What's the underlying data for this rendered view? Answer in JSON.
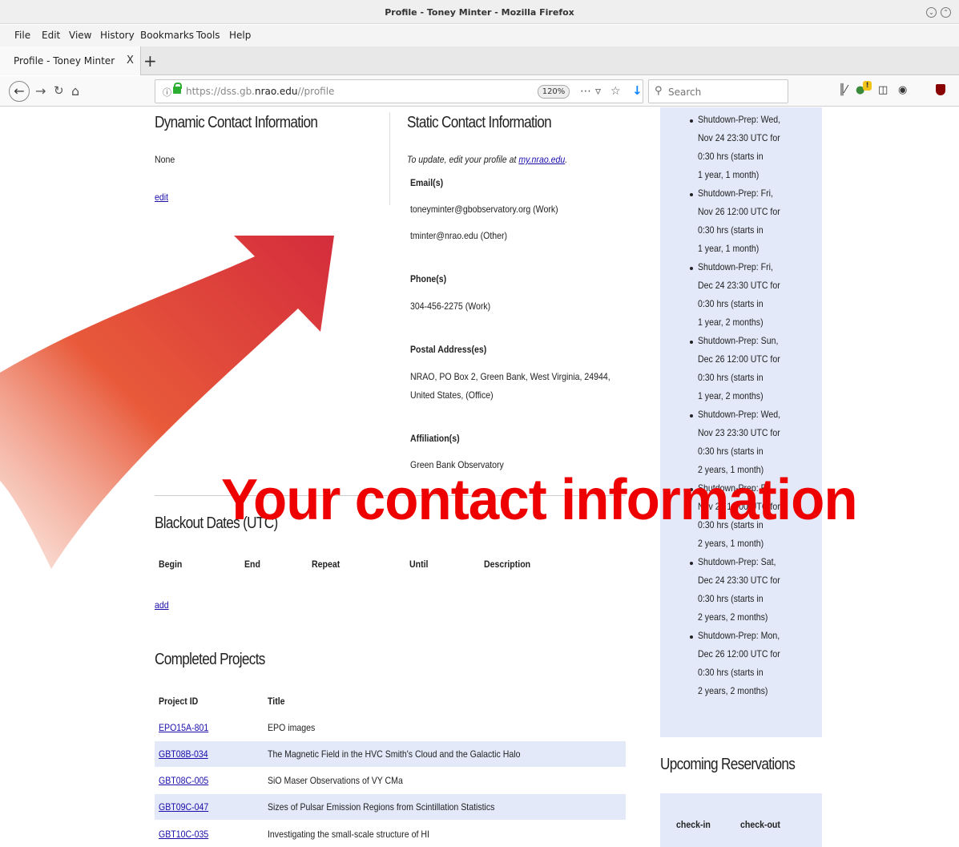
{
  "window": {
    "title": "Profile - Toney Minter - Mozilla Firefox"
  },
  "menubar": {
    "items": [
      "File",
      "Edit",
      "View",
      "History",
      "Bookmarks",
      "Tools",
      "Help"
    ]
  },
  "tabs": [
    {
      "label": "Profile - Toney Minter",
      "close": "X"
    }
  ],
  "newtab_label": "+",
  "navbar": {
    "url_prefix": "https://dss.gb.",
    "url_host": "nrao.edu",
    "url_suffix": "//profile",
    "zoom": "120%",
    "search_placeholder": "Search"
  },
  "dynamic_contact": {
    "heading": "Dynamic Contact Information",
    "value": "None",
    "edit_link": "edit"
  },
  "static_contact": {
    "heading": "Static Contact Information",
    "note_prefix": "To update, edit your profile at ",
    "note_link": "my.nrao.edu",
    "note_suffix": ".",
    "emails_label": "Email(s)",
    "emails": [
      "toneyminter@gbobservatory.org (Work)",
      "tminter@nrao.edu (Other)"
    ],
    "phones_label": "Phone(s)",
    "phones": [
      "304-456-2275 (Work)"
    ],
    "postal_label": "Postal Address(es)",
    "postal_line1": "NRAO, PO Box 2, Green Bank, West Virginia, 24944,",
    "postal_line2": "United States, (Office)",
    "affiliation_label": "Affiliation(s)",
    "affiliations": [
      "Green Bank Observatory"
    ]
  },
  "blackout": {
    "heading": "Blackout Dates (UTC)",
    "columns": [
      "Begin",
      "End",
      "Repeat",
      "Until",
      "Description"
    ],
    "add_link": "add"
  },
  "completed_projects": {
    "heading": "Completed Projects",
    "columns": [
      "Project ID",
      "Title"
    ],
    "rows": [
      {
        "id": "EPO15A-801",
        "title": "EPO images"
      },
      {
        "id": "GBT08B-034",
        "title": "The Magnetic Field in the HVC Smith's Cloud and the Galactic Halo"
      },
      {
        "id": "GBT08C-005",
        "title": "SiO Maser Observations of VY CMa"
      },
      {
        "id": "GBT09C-047",
        "title": "Sizes of Pulsar Emission Regions from Scintillation Statistics"
      },
      {
        "id": "GBT10C-035",
        "title": "Investigating the small-scale structure of HI"
      }
    ]
  },
  "shutdowns": [
    [
      "Shutdown-Prep: Wed,",
      "Nov 24 23:30 UTC for",
      "0:30 hrs (starts in",
      "1 year, 1 month)"
    ],
    [
      "Shutdown-Prep: Fri,",
      "Nov 26 12:00 UTC for",
      "0:30 hrs (starts in",
      "1 year, 1 month)"
    ],
    [
      "Shutdown-Prep: Fri,",
      "Dec 24 23:30 UTC for",
      "0:30 hrs (starts in",
      "1 year, 2 months)"
    ],
    [
      "Shutdown-Prep: Sun,",
      "Dec 26 12:00 UTC for",
      "0:30 hrs (starts in",
      "1 year, 2 months)"
    ],
    [
      "Shutdown-Prep: Wed,",
      "Nov 23 23:30 UTC for",
      "0:30 hrs (starts in",
      "2 years, 1 month)"
    ],
    [
      "Shutdown-Prep: Fri,",
      "Nov 25 12:00 UTC for",
      "0:30 hrs (starts in",
      "2 years, 1 month)"
    ],
    [
      "Shutdown-Prep: Sat,",
      "Dec 24 23:30 UTC for",
      "0:30 hrs (starts in",
      "2 years, 2 months)"
    ],
    [
      "Shutdown-Prep: Mon,",
      "Dec 26 12:00 UTC for",
      "0:30 hrs (starts in",
      "2 years, 2 months)"
    ]
  ],
  "upcoming_reservations": {
    "heading": "Upcoming Reservations",
    "columns": [
      "check-in",
      "check-out"
    ]
  },
  "annotation": {
    "text": "Your contact information",
    "color": "#ee0000",
    "arrow_color_start": "#f9d8cc",
    "arrow_color_end": "#d42c3c"
  }
}
